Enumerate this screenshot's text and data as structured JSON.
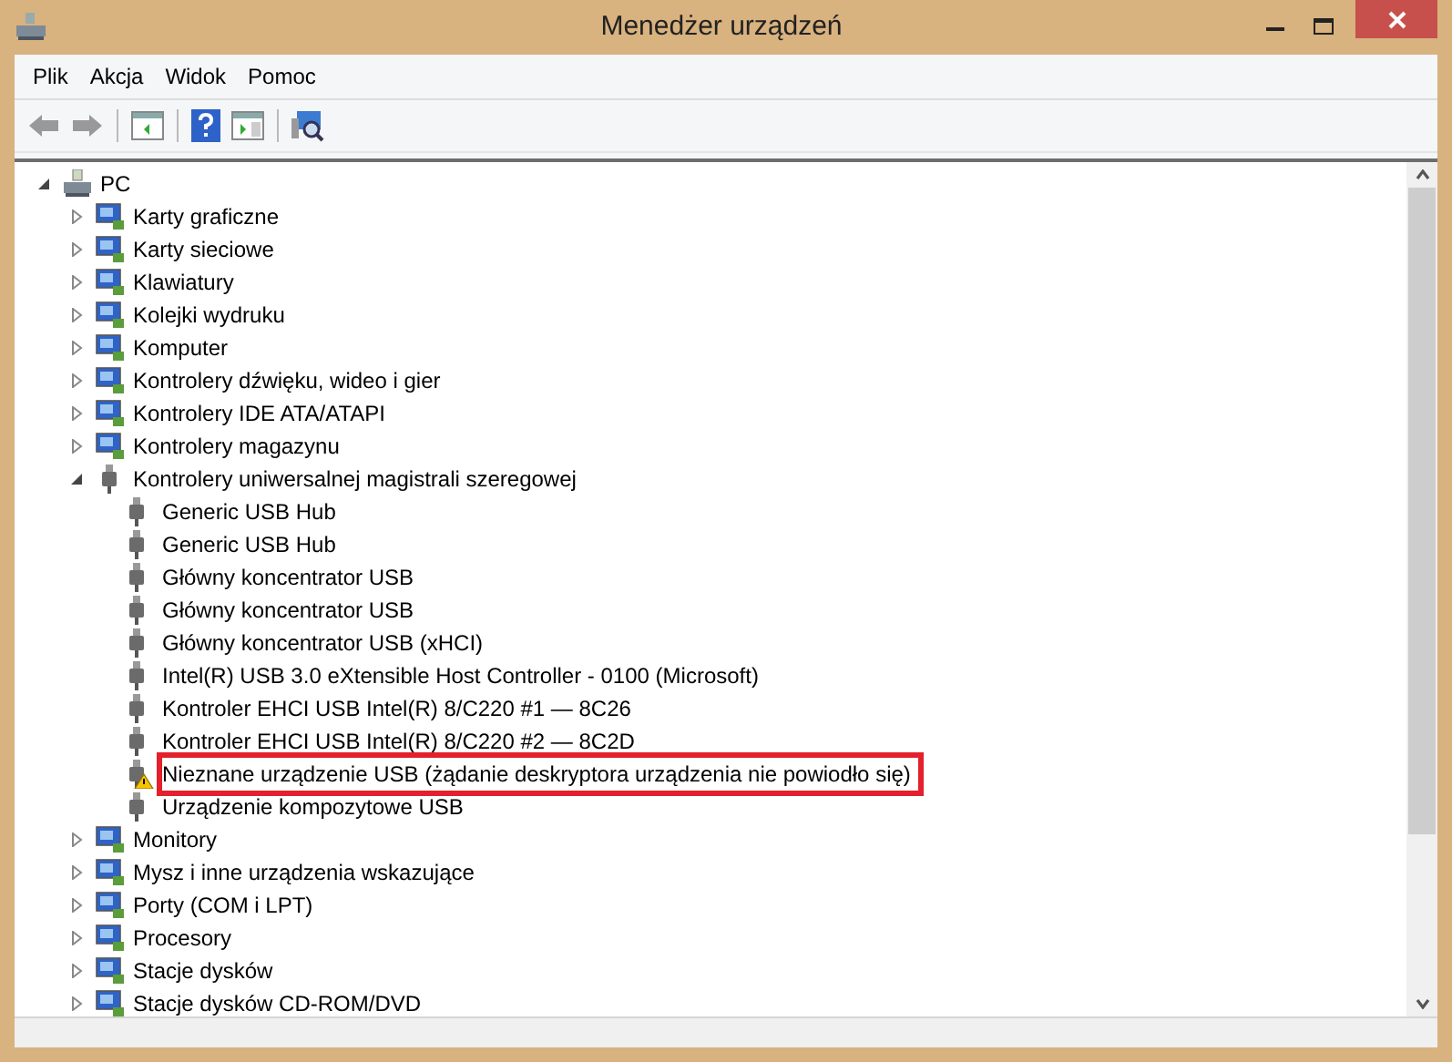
{
  "window": {
    "title": "Menedżer urządzeń"
  },
  "menu": [
    "Plik",
    "Akcja",
    "Widok",
    "Pomoc"
  ],
  "tree": {
    "label": "PC",
    "expanded": true,
    "children": [
      {
        "label": "Karty graficzne",
        "expanded": false
      },
      {
        "label": "Karty sieciowe",
        "expanded": false
      },
      {
        "label": "Klawiatury",
        "expanded": false
      },
      {
        "label": "Kolejki wydruku",
        "expanded": false
      },
      {
        "label": "Komputer",
        "expanded": false
      },
      {
        "label": "Kontrolery dźwięku, wideo i gier",
        "expanded": false
      },
      {
        "label": "Kontrolery IDE ATA/ATAPI",
        "expanded": false
      },
      {
        "label": "Kontrolery magazynu",
        "expanded": false
      },
      {
        "label": "Kontrolery uniwersalnej magistrali szeregowej",
        "expanded": true,
        "children": [
          {
            "label": "Generic USB Hub",
            "warning": false,
            "highlighted": false
          },
          {
            "label": "Generic USB Hub",
            "warning": false,
            "highlighted": false
          },
          {
            "label": "Główny koncentrator USB",
            "warning": false,
            "highlighted": false
          },
          {
            "label": "Główny koncentrator USB",
            "warning": false,
            "highlighted": false
          },
          {
            "label": "Główny koncentrator USB (xHCI)",
            "warning": false,
            "highlighted": false
          },
          {
            "label": "Intel(R) USB 3.0 eXtensible Host Controller - 0100 (Microsoft)",
            "warning": false,
            "highlighted": false
          },
          {
            "label": "Kontroler EHCI USB Intel(R) 8/C220 #1 — 8C26",
            "warning": false,
            "highlighted": false
          },
          {
            "label": "Kontroler EHCI USB Intel(R) 8/C220 #2 — 8C2D",
            "warning": false,
            "highlighted": false
          },
          {
            "label": "Nieznane urządzenie USB (żądanie deskryptora urządzenia nie powiodło się)",
            "warning": true,
            "highlighted": true
          },
          {
            "label": "Urządzenie kompozytowe USB",
            "warning": false,
            "highlighted": false
          }
        ]
      },
      {
        "label": "Monitory",
        "expanded": false
      },
      {
        "label": "Mysz i inne urządzenia wskazujące",
        "expanded": false
      },
      {
        "label": "Porty (COM i LPT)",
        "expanded": false
      },
      {
        "label": "Procesory",
        "expanded": false
      },
      {
        "label": "Stacje dysków",
        "expanded": false
      },
      {
        "label": "Stacje dysków CD-ROM/DVD",
        "expanded": false
      }
    ]
  }
}
